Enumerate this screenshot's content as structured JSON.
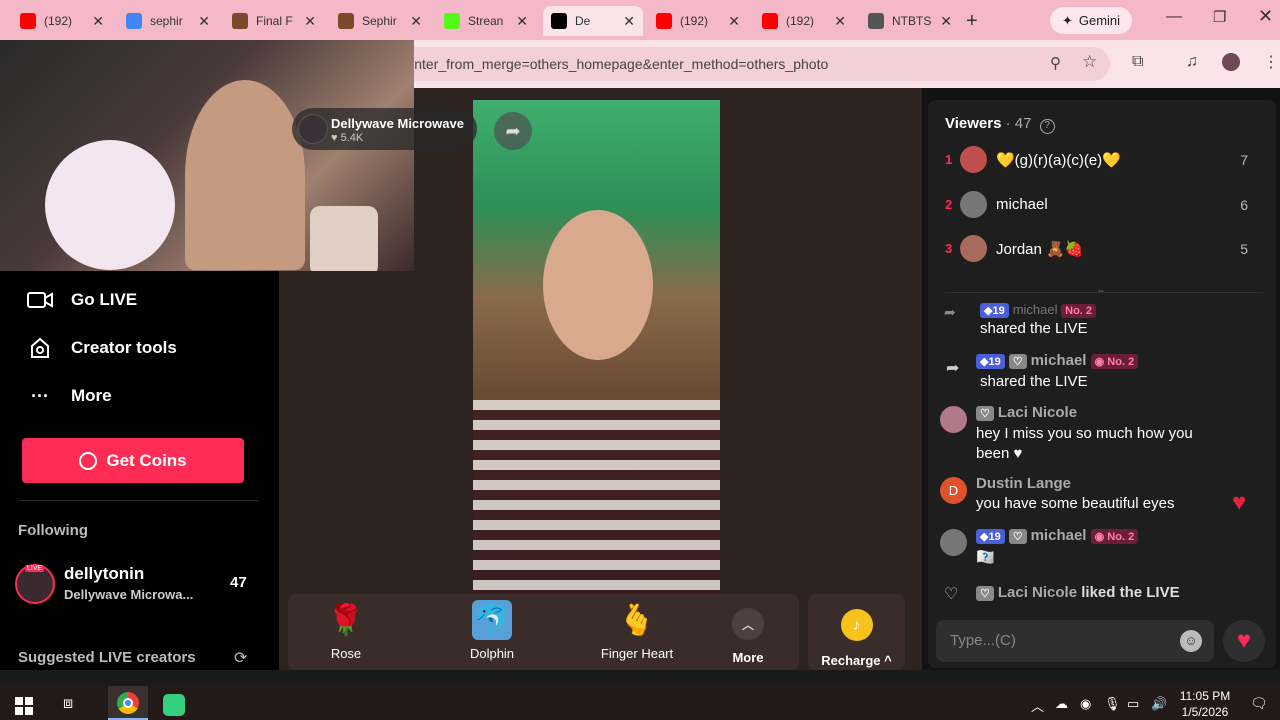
{
  "browser": {
    "tabs": [
      {
        "label": "(192) ",
        "favicon": "youtube-icon",
        "color": "#ff0000"
      },
      {
        "label": "sephir",
        "favicon": "google-icon",
        "color": "#4285f4"
      },
      {
        "label": "Final F",
        "favicon": "image-icon",
        "color": "#7a4a2a"
      },
      {
        "label": "Sephir",
        "favicon": "image-icon",
        "color": "#7a4a2a"
      },
      {
        "label": "Strean",
        "favicon": "kick-icon",
        "color": "#53fc18"
      },
      {
        "label": "De",
        "favicon": "tiktok-icon",
        "color": "#000000"
      },
      {
        "label": "(192) ",
        "favicon": "youtube-icon",
        "color": "#ff0000"
      },
      {
        "label": "(192) ",
        "favicon": "youtube-icon",
        "color": "#ff0000"
      },
      {
        "label": "NTBTS",
        "favicon": "archive-icon",
        "color": "#555555"
      }
    ],
    "gemini_label": "Gemini",
    "url": "https://www.tiktok.com/@dellytonin/live?enter_from_merge=others_homepage&enter_method=others_photo"
  },
  "overlay": {
    "streamer_name": "Dellywave Microwave",
    "likes": "5.4K"
  },
  "sidebar": {
    "nav": [
      {
        "label": "Go LIVE",
        "icon": "video-camera-icon"
      },
      {
        "label": "Creator tools",
        "icon": "creator-tools-icon"
      },
      {
        "label": "More",
        "icon": "more-dots-icon"
      }
    ],
    "get_coins": "Get Coins",
    "following_heading": "Following",
    "following_user": "dellytonin",
    "following_sub": "Dellywave Microwa...",
    "following_count": "47",
    "suggested_heading": "Suggested LIVE creators",
    "live_badge": "LIVE"
  },
  "viewers": {
    "title": "Viewers",
    "count_label": " · 47",
    "list": [
      {
        "rank": "1",
        "name": "💛(g)(r)(a)(c)(e)💛",
        "count": "7",
        "avatar_color": "#c0504d"
      },
      {
        "rank": "2",
        "name": "michael",
        "count": "6",
        "avatar_color": "#777777"
      },
      {
        "rank": "3",
        "name": "Jordan 🧸🍓",
        "count": "5",
        "avatar_color": "#a86a5a"
      }
    ]
  },
  "chat": {
    "messages": [
      {
        "user": "michael",
        "level": "19",
        "rank_badge": "No. 2",
        "text": "shared the LIVE"
      },
      {
        "user": "Laci Nicole",
        "text": "hey I miss you so much how you been ♥"
      },
      {
        "user": "Dustin Lange",
        "avatar_letter": "D",
        "text": "you have some beautiful eyes"
      },
      {
        "user": "michael",
        "level": "19",
        "rank_badge": "No. 2",
        "text": "🇽🇽"
      },
      {
        "user": "Laci Nicole",
        "text": "liked the LIVE"
      }
    ],
    "partial_top_user": "michael",
    "partial_top_text": "shared the LIVE",
    "input_placeholder": "Type...(C)"
  },
  "gifts": {
    "items": [
      {
        "label": "Rose",
        "emoji": "🌹"
      },
      {
        "label": "Dolphin",
        "emoji": "🐬"
      },
      {
        "label": "Finger Heart",
        "emoji": "🫰"
      }
    ],
    "more_label": "More",
    "recharge_label": "Recharge"
  },
  "taskbar": {
    "time": "11:05 PM",
    "date": "1/5/2026"
  },
  "colors": {
    "accent": "#fe2c55",
    "tab_strip": "#f5b8c8"
  }
}
